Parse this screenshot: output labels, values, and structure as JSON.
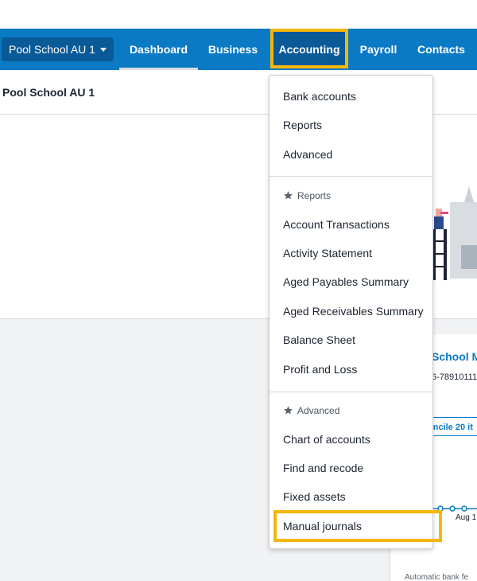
{
  "topnav": {
    "org_switcher": "Pool School AU 1",
    "items": [
      "Dashboard",
      "Business",
      "Accounting",
      "Payroll",
      "Contacts"
    ]
  },
  "page": {
    "org_title": "Pool School AU 1"
  },
  "card": {
    "title": "School M",
    "account_number": "6-78910111",
    "reconcile_button": "oncile 20 it",
    "chart_date": "Aug 1",
    "footer_text": "Automatic bank fe"
  },
  "accounting_menu": {
    "top_items": [
      "Bank accounts",
      "Reports",
      "Advanced"
    ],
    "reports_header": "Reports",
    "report_items": [
      "Account Transactions",
      "Activity Statement",
      "Aged Payables Summary",
      "Aged Receivables Summary",
      "Balance Sheet",
      "Profit and Loss"
    ],
    "advanced_header": "Advanced",
    "advanced_items": [
      "Chart of accounts",
      "Find and recode",
      "Fixed assets",
      "Manual journals"
    ]
  },
  "colors": {
    "nav_blue": "#0a7ac4",
    "nav_dark": "#0a5a98",
    "highlight": "#f5b60a"
  },
  "icons": {
    "caret": "caret-down-icon",
    "star": "star-icon"
  }
}
